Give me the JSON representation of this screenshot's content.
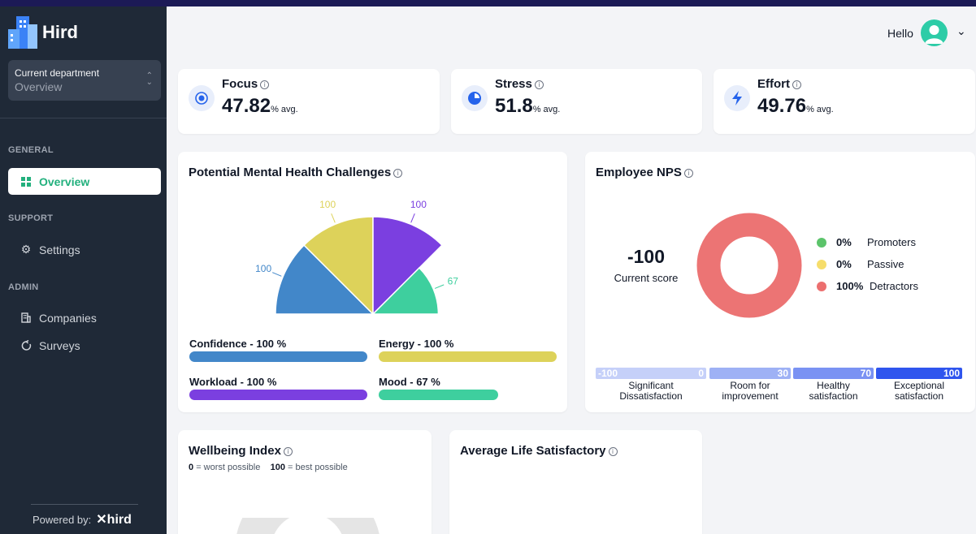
{
  "app": {
    "name": "Hird"
  },
  "sidebar": {
    "department_label": "Current department",
    "department_value": "Overview",
    "sections": {
      "general": "GENERAL",
      "support": "SUPPORT",
      "admin": "ADMIN"
    },
    "items": [
      {
        "label": "Overview",
        "icon": "grid-icon",
        "active": true
      },
      {
        "label": "Settings",
        "icon": "gear-icon"
      },
      {
        "label": "Companies",
        "icon": "building-icon"
      },
      {
        "label": "Surveys",
        "icon": "survey-icon"
      }
    ],
    "powered_by": "Powered by:",
    "powered_brand": "hird"
  },
  "header": {
    "greeting": "Hello"
  },
  "stats": [
    {
      "title": "Focus",
      "value": "47.82",
      "unit": "% avg.",
      "icon": "focus-icon"
    },
    {
      "title": "Stress",
      "value": "51.8",
      "unit": "% avg.",
      "icon": "stress-icon"
    },
    {
      "title": "Effort",
      "value": "49.76",
      "unit": "% avg.",
      "icon": "bolt-icon"
    }
  ],
  "mental_health": {
    "title": "Potential Mental Health Challenges",
    "bars": [
      {
        "label": "Confidence - 100 %",
        "value": 100,
        "color": "#4287c9"
      },
      {
        "label": "Energy - 100 %",
        "value": 100,
        "color": "#ddd25a"
      },
      {
        "label": "Workload - 100 %",
        "value": 100,
        "color": "#7b3fe0"
      },
      {
        "label": "Mood - 67 %",
        "value": 67,
        "color": "#3ecf9e"
      }
    ]
  },
  "chart_data": {
    "type": "polar-area",
    "categories": [
      "Confidence",
      "Energy",
      "Workload",
      "Mood"
    ],
    "values": [
      100,
      100,
      100,
      67
    ],
    "value_labels": [
      "100",
      "100",
      "100",
      "67"
    ],
    "colors": [
      "#4287c9",
      "#ddd25a",
      "#7b3fe0",
      "#3ecf9e"
    ],
    "max": 100
  },
  "nps": {
    "title": "Employee NPS",
    "score": "-100",
    "score_label": "Current score",
    "legend": [
      {
        "pct": "0%",
        "label": "Promoters",
        "color": "#5cc46b"
      },
      {
        "pct": "0%",
        "label": "Passive",
        "color": "#f6dd6b"
      },
      {
        "pct": "100%",
        "label": "Detractors",
        "color": "#ec6f6f"
      }
    ],
    "donut_color": "#ec7474",
    "scale": [
      {
        "start": "-100",
        "end": "0",
        "label1": "Significant",
        "label2": "Dissatisfaction",
        "color": "#c5d0f9"
      },
      {
        "end": "30",
        "label1": "Room for",
        "label2": "improvement",
        "color": "#9eb1f5"
      },
      {
        "end": "70",
        "label1": "Healthy",
        "label2": "satisfaction",
        "color": "#7a92f3"
      },
      {
        "end": "100",
        "label1": "Exceptional",
        "label2": "satisfaction",
        "color": "#2f55ee"
      }
    ]
  },
  "wellbeing": {
    "title": "Wellbeing Index",
    "min_value": "0",
    "min_text": "= worst possible",
    "max_value": "100",
    "max_text": "= best possible"
  },
  "life": {
    "title": "Average Life Satisfactory"
  }
}
